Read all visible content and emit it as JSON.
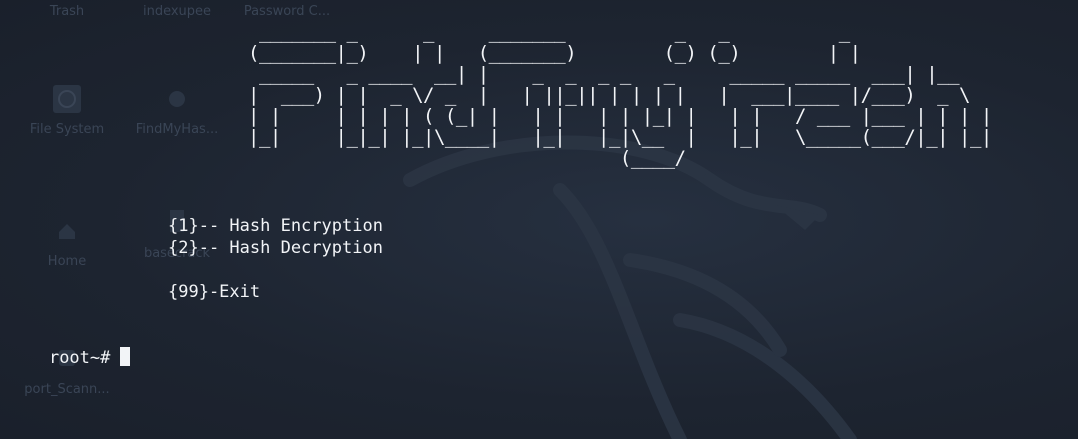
{
  "desktop": {
    "icons": [
      {
        "label": "Trash",
        "icon": "trash-icon"
      },
      {
        "label": "indexupee",
        "icon": "folder-icon"
      },
      {
        "label": "Password C...",
        "icon": "file-icon"
      },
      {
        "label": "File System",
        "icon": "drive-icon"
      },
      {
        "label": "FindMyHas...",
        "icon": "folder-icon"
      },
      {
        "label": "Home",
        "icon": "home-icon"
      },
      {
        "label": "basecrack",
        "icon": "folder-icon"
      },
      {
        "label": "port_Scann...",
        "icon": "folder-icon"
      }
    ]
  },
  "terminal": {
    "banner": " _______ _      _     _______          _   _          _\n(_______|_)    | |   (_______)        (_) (_)        | |\n _____   _ ____  __| |    _  _  _ _   _     _____ _____  ___| |__\n|  ___) | |  _ \\/ _  |   | ||_|| | | | |   |  ___|____ |/___)  _ \\\n| |     | | | | ( (_| |   | |   | | |_| |   | |   / ___ |___ | | | |\n|_|     |_|_| |_|\\____|   |_|   |_|\\__  |   |_|   \\_____(___/|_| |_|\n                                  (____/",
    "menu_item_1": "{1}-- Hash Encryption",
    "menu_item_2": "{2}-- Hash Decryption",
    "menu_exit": "{99}-Exit",
    "prompt": "root~#"
  },
  "colors": {
    "background": "#1f2633",
    "text": "#f2f4f7"
  }
}
